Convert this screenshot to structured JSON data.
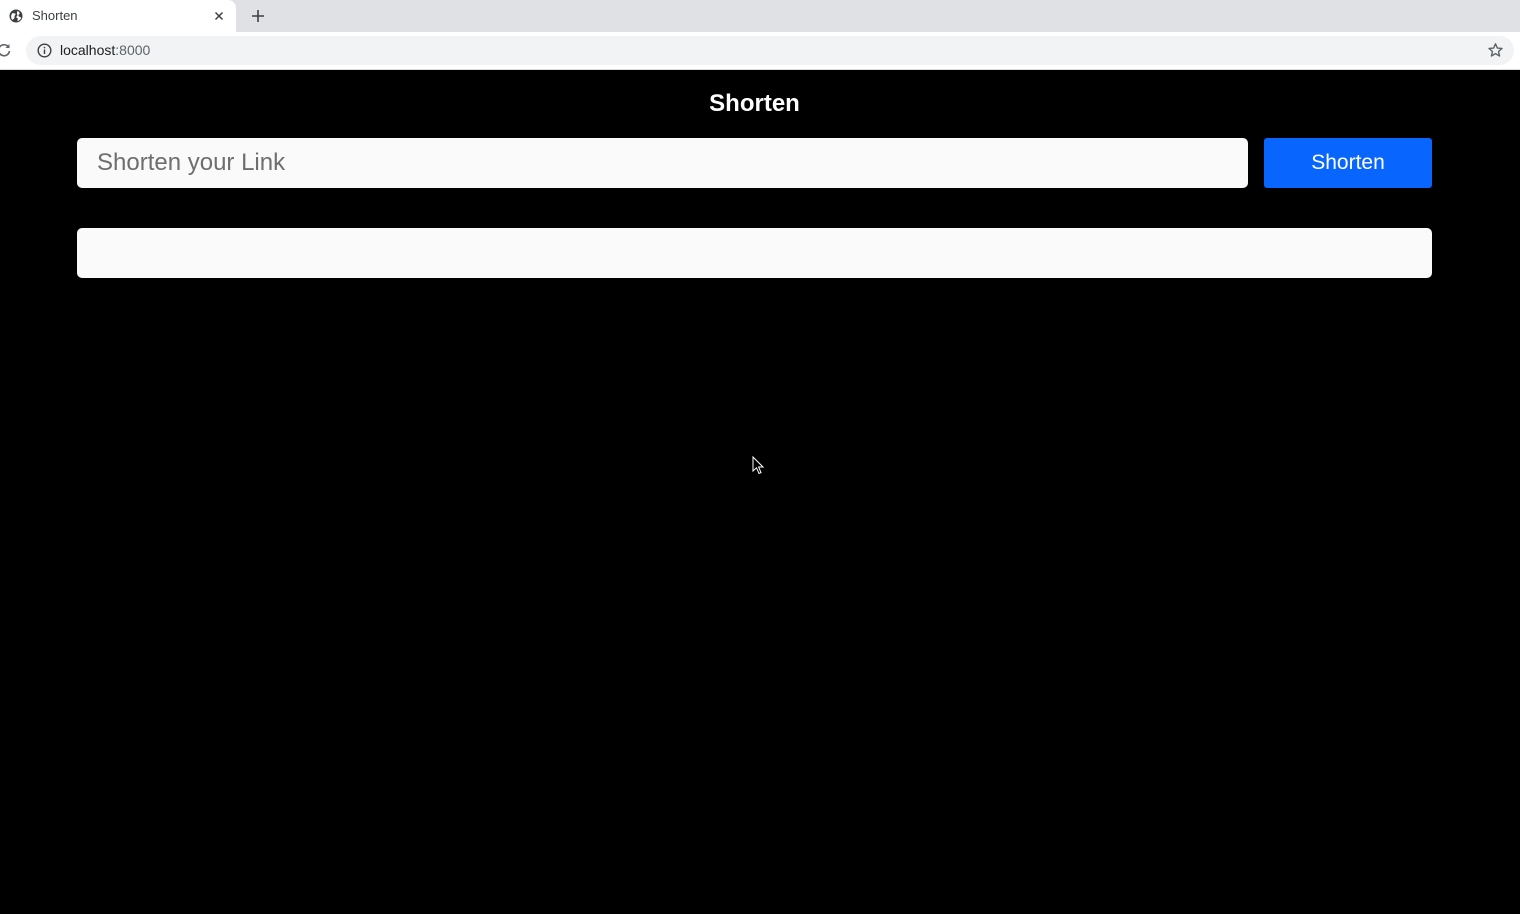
{
  "browser": {
    "tab": {
      "title": "Shorten"
    },
    "address_bar": {
      "host": "localhost",
      "port": ":8000"
    },
    "icons": {
      "favicon": "globe-icon",
      "tab_close": "close-icon",
      "new_tab": "plus-icon",
      "reload": "reload-icon",
      "site_info": "info-icon",
      "bookmark": "star-icon"
    }
  },
  "page": {
    "title": "Shorten",
    "input": {
      "placeholder": "Shorten your Link",
      "value": ""
    },
    "shorten_button_label": "Shorten",
    "result_text": ""
  },
  "colors": {
    "page_background": "#000000",
    "button_background": "#0866ff",
    "field_background": "#fafafa",
    "title_color": "#ffffff"
  }
}
